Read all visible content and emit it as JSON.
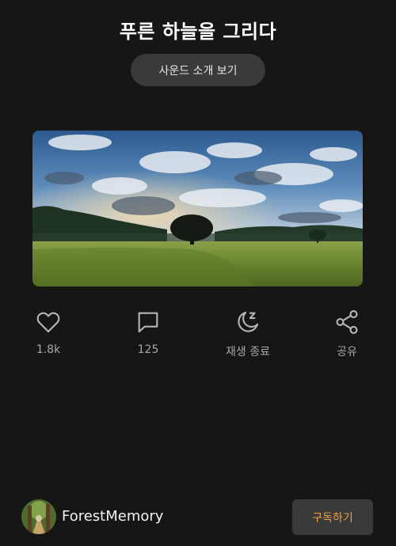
{
  "header": {
    "title": "푸른 하늘을 그리다",
    "sound_intro_label": "사운드 소개 보기"
  },
  "actions": [
    {
      "icon": "heart-icon",
      "label": "1.8k"
    },
    {
      "icon": "comment-icon",
      "label": "125"
    },
    {
      "icon": "moon-sleep-icon",
      "label": "재생 종료"
    },
    {
      "icon": "share-icon",
      "label": "공유"
    }
  ],
  "footer": {
    "channel_name": "ForestMemory",
    "subscribe_label": "구독하기"
  },
  "colors": {
    "background": "#161616",
    "button_bg": "#3a3a3a",
    "accent": "#f0a040",
    "muted_text": "#a7a7a7"
  }
}
